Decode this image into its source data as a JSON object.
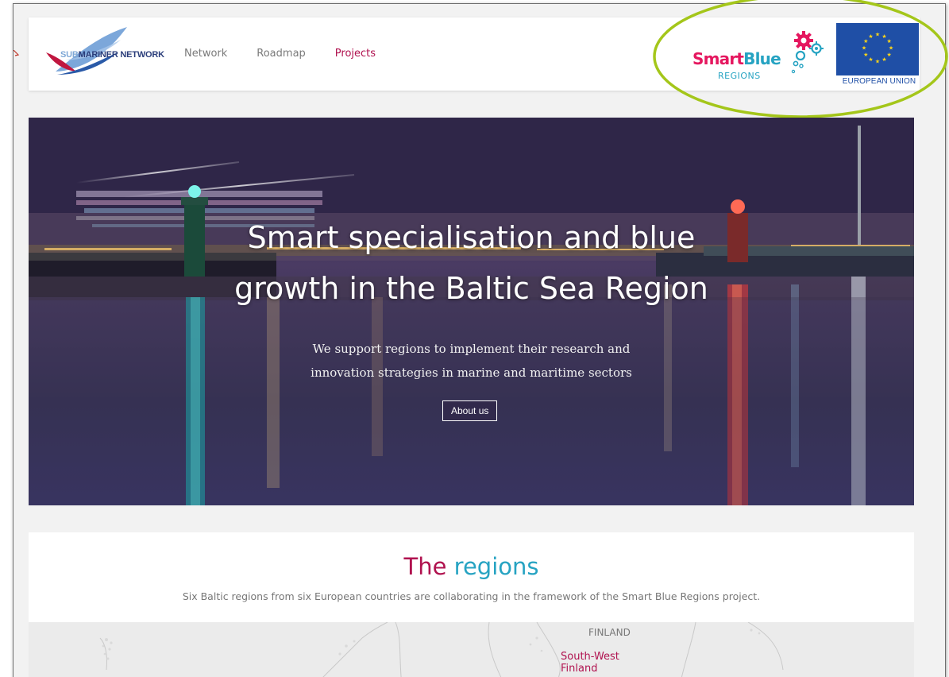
{
  "header": {
    "logo": {
      "sub": "SUB",
      "mariner_network": "MARINER NETWORK"
    },
    "nav": [
      {
        "label": "Network",
        "active": false
      },
      {
        "label": "Roadmap",
        "active": false
      },
      {
        "label": "Projects",
        "active": true
      }
    ],
    "partner_logo": {
      "smart": "Smart",
      "blue": "Blue",
      "regions": "REGIONS"
    },
    "eu_label": "EUROPEAN UNION"
  },
  "hero": {
    "title_line1": "Smart specialisation and blue",
    "title_line2": "growth in the Baltic Sea Region",
    "subtitle_line1": "We support regions to implement their research and",
    "subtitle_line2": "innovation strategies in marine and maritime sectors",
    "cta_label": "About us"
  },
  "regions": {
    "title_the": "The",
    "title_word": "regions",
    "description": "Six Baltic regions from six European countries are collaborating in the framework of the Smart Blue Regions project.",
    "map_labels": {
      "country": "FINLAND",
      "region": "South-West Finland"
    }
  },
  "colors": {
    "accent_magenta": "#b0124f",
    "accent_teal": "#26a3c2",
    "smart_pink": "#e5175f",
    "eu_blue": "#1f4fa6",
    "annotation_green": "#a4c61a"
  },
  "icons": [
    "sub-mariner-wave-logo",
    "smart-blue-gears-icon",
    "eu-stars-flag"
  ]
}
